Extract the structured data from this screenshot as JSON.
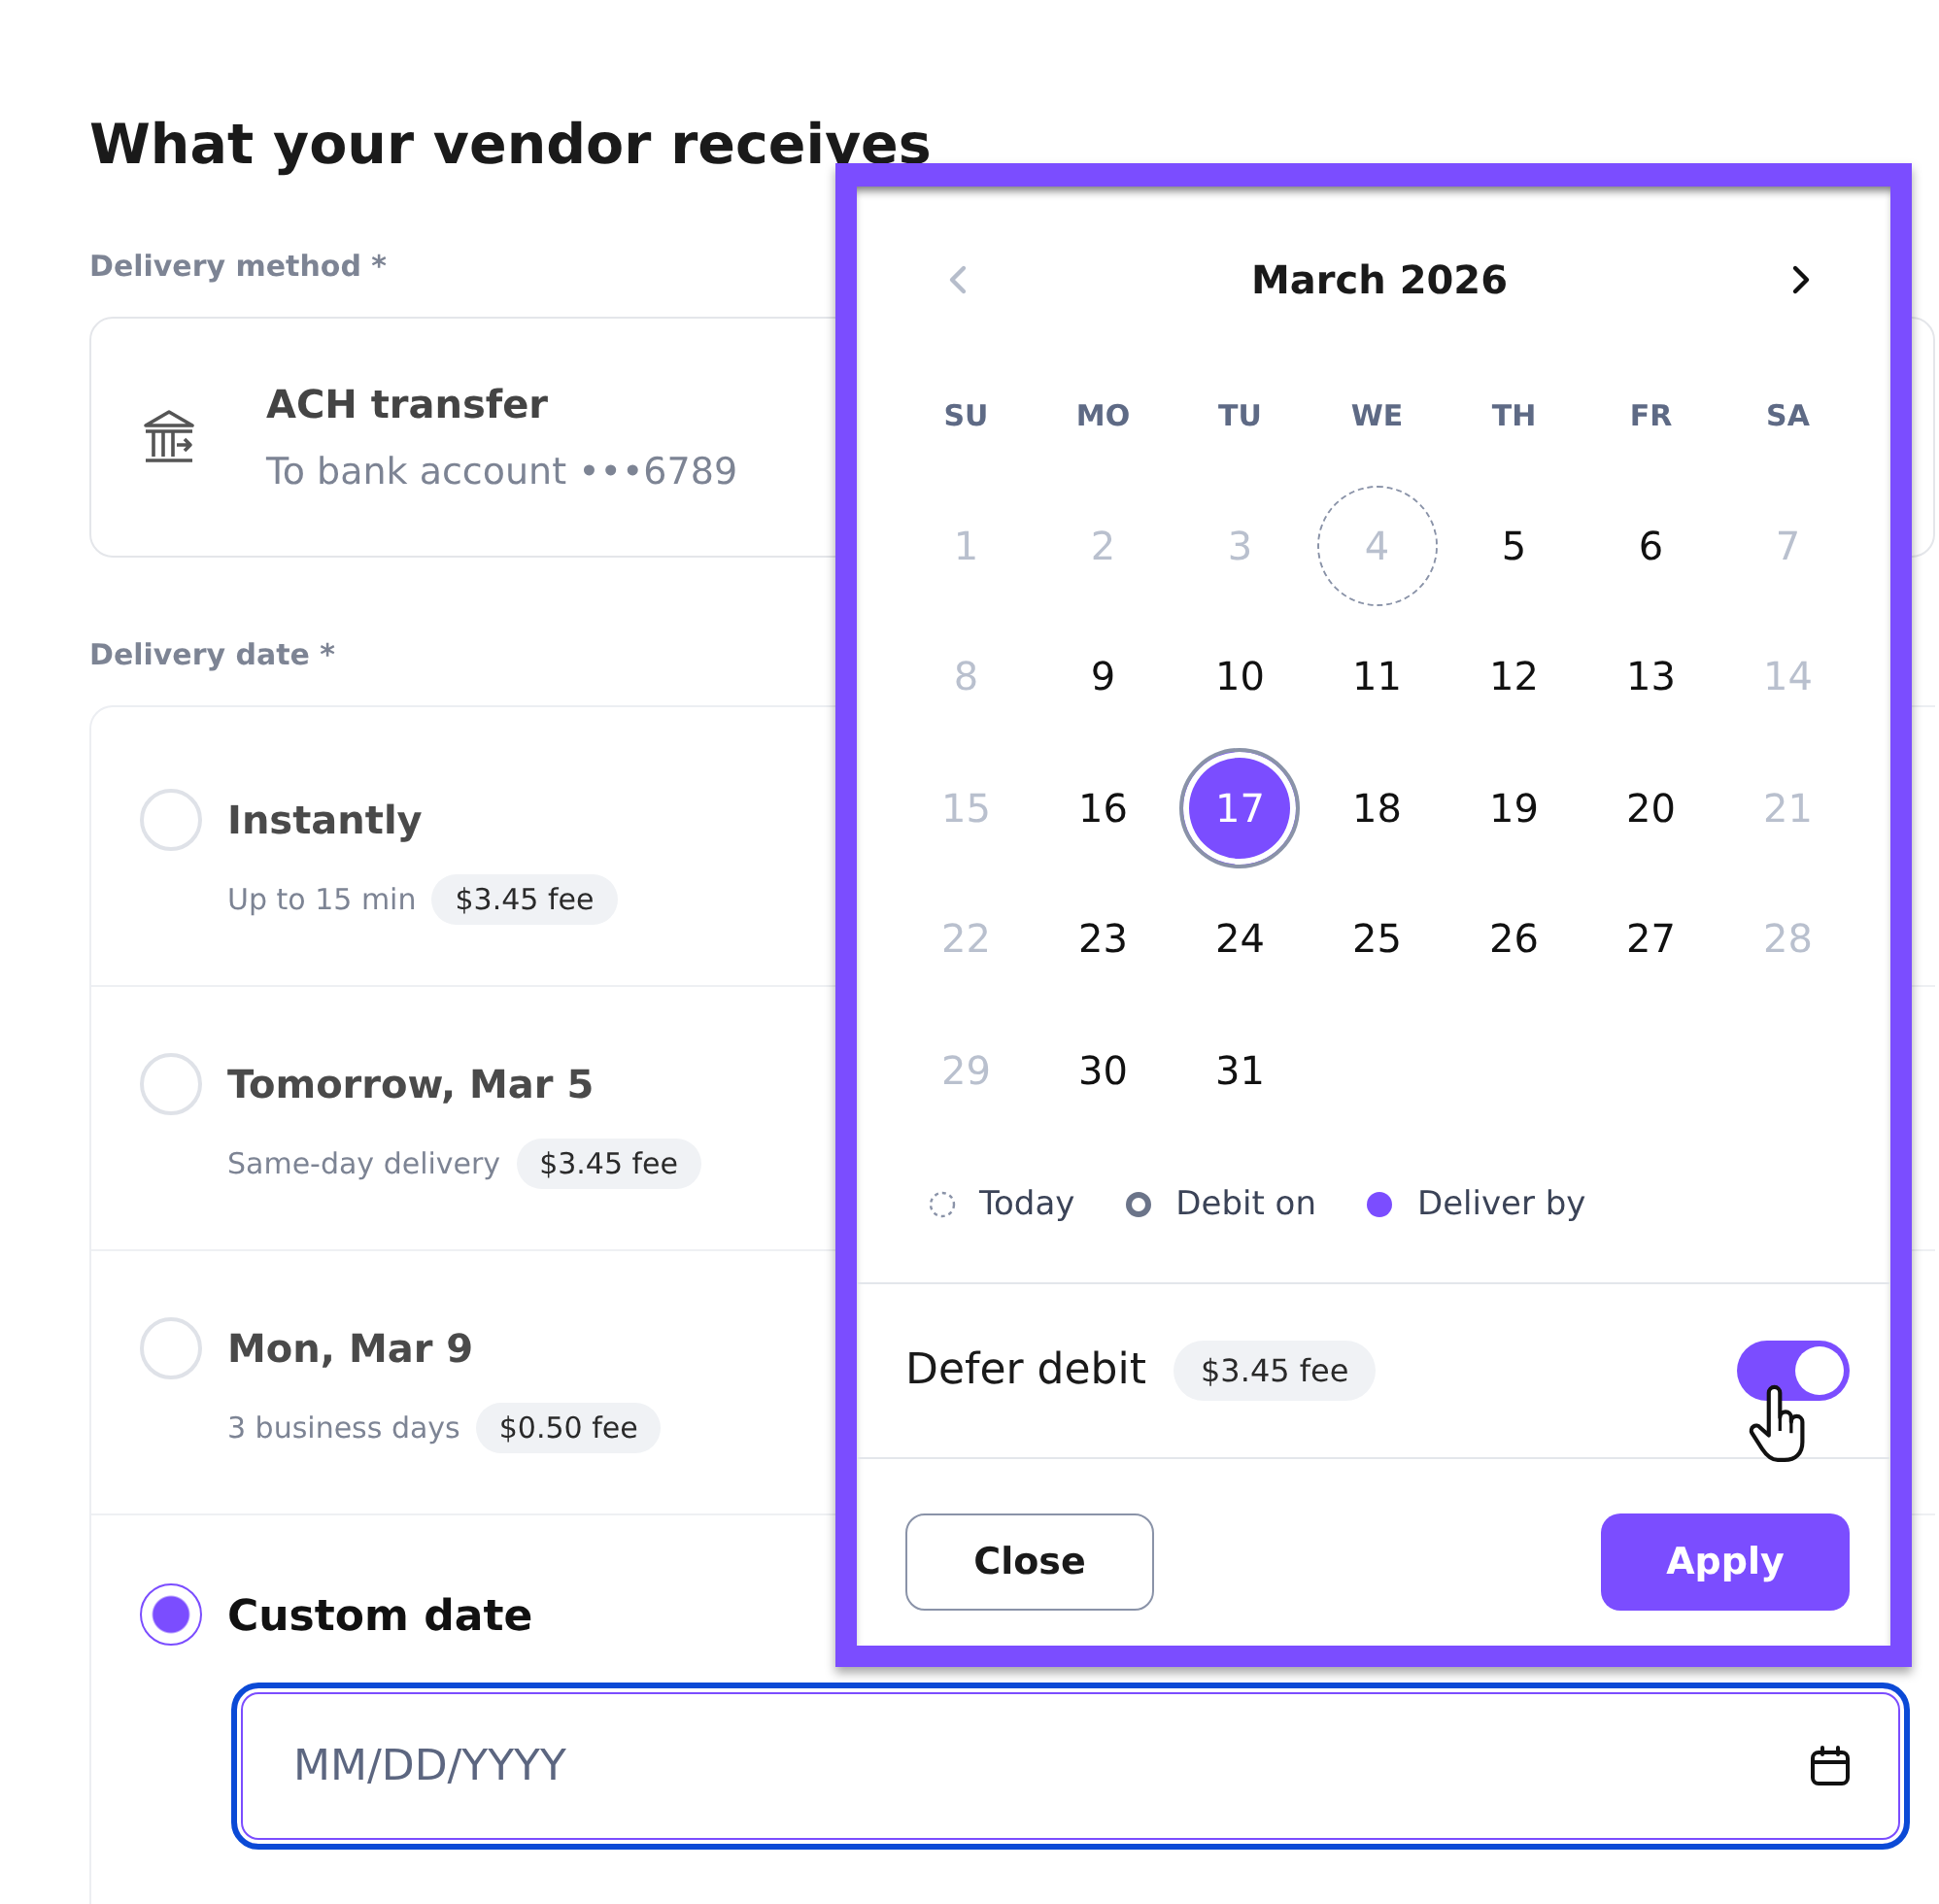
{
  "heading": "What your vendor receives",
  "delivery_method": {
    "label": "Delivery method *",
    "title": "ACH transfer",
    "subtitle": "To bank account •••6789"
  },
  "delivery_date": {
    "label": "Delivery date *",
    "options": [
      {
        "kind": "preset",
        "title": "Instantly",
        "detail": "Up to 15 min",
        "fee": "$3.45 fee",
        "selected": false
      },
      {
        "kind": "preset",
        "title": "Tomorrow, Mar 5",
        "detail": "Same-day delivery",
        "fee": "$3.45 fee",
        "selected": false
      },
      {
        "kind": "preset",
        "title": "Mon, Mar 9",
        "detail": "3 business days",
        "fee": "$0.50 fee",
        "selected": false
      },
      {
        "kind": "custom",
        "title": "Custom date",
        "placeholder": "MM/DD/YYYY",
        "selected": true
      }
    ]
  },
  "calendar": {
    "month": "March 2026",
    "prev_month": {
      "disabled": true
    },
    "next_month": {
      "disabled": false
    },
    "weekdays": [
      "SU",
      "MO",
      "TU",
      "WE",
      "TH",
      "FR",
      "SA"
    ],
    "days": [
      {
        "label": "1",
        "disabled": true,
        "today": false,
        "debit_on": false,
        "selected": false
      },
      {
        "label": "2",
        "disabled": true,
        "today": false,
        "debit_on": false,
        "selected": false
      },
      {
        "label": "3",
        "disabled": true,
        "today": false,
        "debit_on": false,
        "selected": false
      },
      {
        "label": "4",
        "disabled": true,
        "today": true,
        "debit_on": false,
        "selected": false
      },
      {
        "label": "5",
        "disabled": false,
        "today": false,
        "debit_on": false,
        "selected": false
      },
      {
        "label": "6",
        "disabled": false,
        "today": false,
        "debit_on": false,
        "selected": false
      },
      {
        "label": "7",
        "disabled": true,
        "today": false,
        "debit_on": false,
        "selected": false
      },
      {
        "label": "8",
        "disabled": true,
        "today": false,
        "debit_on": false,
        "selected": false
      },
      {
        "label": "9",
        "disabled": false,
        "today": false,
        "debit_on": false,
        "selected": false
      },
      {
        "label": "10",
        "disabled": false,
        "today": false,
        "debit_on": false,
        "selected": false
      },
      {
        "label": "11",
        "disabled": false,
        "today": false,
        "debit_on": false,
        "selected": false
      },
      {
        "label": "12",
        "disabled": false,
        "today": false,
        "debit_on": false,
        "selected": false
      },
      {
        "label": "13",
        "disabled": false,
        "today": false,
        "debit_on": false,
        "selected": false
      },
      {
        "label": "14",
        "disabled": true,
        "today": false,
        "debit_on": false,
        "selected": false
      },
      {
        "label": "15",
        "disabled": true,
        "today": false,
        "debit_on": false,
        "selected": false
      },
      {
        "label": "16",
        "disabled": false,
        "today": false,
        "debit_on": false,
        "selected": false
      },
      {
        "label": "17",
        "disabled": false,
        "today": false,
        "debit_on": true,
        "selected": true
      },
      {
        "label": "18",
        "disabled": false,
        "today": false,
        "debit_on": false,
        "selected": false
      },
      {
        "label": "19",
        "disabled": false,
        "today": false,
        "debit_on": false,
        "selected": false
      },
      {
        "label": "20",
        "disabled": false,
        "today": false,
        "debit_on": false,
        "selected": false
      },
      {
        "label": "21",
        "disabled": true,
        "today": false,
        "debit_on": false,
        "selected": false
      },
      {
        "label": "22",
        "disabled": true,
        "today": false,
        "debit_on": false,
        "selected": false
      },
      {
        "label": "23",
        "disabled": false,
        "today": false,
        "debit_on": false,
        "selected": false
      },
      {
        "label": "24",
        "disabled": false,
        "today": false,
        "debit_on": false,
        "selected": false
      },
      {
        "label": "25",
        "disabled": false,
        "today": false,
        "debit_on": false,
        "selected": false
      },
      {
        "label": "26",
        "disabled": false,
        "today": false,
        "debit_on": false,
        "selected": false
      },
      {
        "label": "27",
        "disabled": false,
        "today": false,
        "debit_on": false,
        "selected": false
      },
      {
        "label": "28",
        "disabled": true,
        "today": false,
        "debit_on": false,
        "selected": false
      },
      {
        "label": "29",
        "disabled": true,
        "today": false,
        "debit_on": false,
        "selected": false
      },
      {
        "label": "30",
        "disabled": false,
        "today": false,
        "debit_on": false,
        "selected": false
      },
      {
        "label": "31",
        "disabled": false,
        "today": false,
        "debit_on": false,
        "selected": false
      }
    ],
    "legend": [
      {
        "kind": "today",
        "label": "Today"
      },
      {
        "kind": "debit",
        "label": "Debit on"
      },
      {
        "kind": "deliver",
        "label": "Deliver by"
      }
    ],
    "defer_debit": {
      "label": "Defer debit",
      "fee": "$3.45 fee",
      "on": true
    },
    "buttons": [
      {
        "kind": "secondary",
        "label": "Close"
      },
      {
        "kind": "primary",
        "label": "Apply"
      }
    ]
  }
}
